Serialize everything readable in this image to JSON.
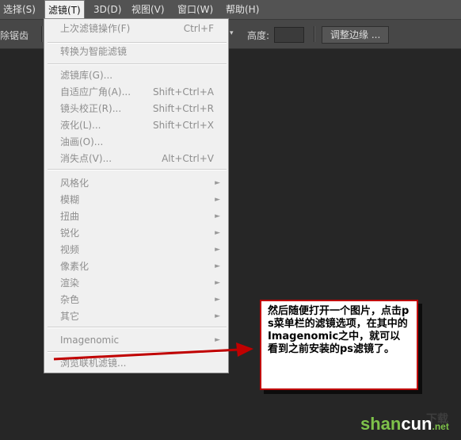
{
  "menubar": {
    "items": [
      {
        "label": "选择(S)"
      },
      {
        "label": "滤镜(T)",
        "active": true
      },
      {
        "label": "3D(D)"
      },
      {
        "label": "视图(V)"
      },
      {
        "label": "窗口(W)"
      },
      {
        "label": "帮助(H)"
      }
    ]
  },
  "optionsbar": {
    "partial_label": "除锯齿",
    "height_label": "高度:",
    "refine_edge_label": "调整边缘 ..."
  },
  "filter_menu": {
    "items": [
      {
        "label": "上次滤镜操作(F)",
        "shortcut": "Ctrl+F"
      },
      {
        "label": "转换为智能滤镜",
        "shortcut": ""
      },
      {
        "label": "滤镜库(G)...",
        "shortcut": ""
      },
      {
        "label": "自适应广角(A)...",
        "shortcut": "Shift+Ctrl+A"
      },
      {
        "label": "镜头校正(R)...",
        "shortcut": "Shift+Ctrl+R"
      },
      {
        "label": "液化(L)...",
        "shortcut": "Shift+Ctrl+X"
      },
      {
        "label": "油画(O)...",
        "shortcut": ""
      },
      {
        "label": "消失点(V)...",
        "shortcut": "Alt+Ctrl+V"
      },
      {
        "label": "风格化",
        "submenu": true
      },
      {
        "label": "模糊",
        "submenu": true
      },
      {
        "label": "扭曲",
        "submenu": true
      },
      {
        "label": "锐化",
        "submenu": true
      },
      {
        "label": "视频",
        "submenu": true
      },
      {
        "label": "像素化",
        "submenu": true
      },
      {
        "label": "渲染",
        "submenu": true
      },
      {
        "label": "杂色",
        "submenu": true
      },
      {
        "label": "其它",
        "submenu": true
      },
      {
        "label": "Imagenomic",
        "submenu": true
      },
      {
        "label": "浏览联机滤镜...",
        "shortcut": ""
      }
    ],
    "submenu_glyph": "►"
  },
  "callout": {
    "text": "然后随便打开一个图片，点击ps菜单栏的滤镜选项，在其中的Imagenomic之中，就可以看到之前安装的ps滤镜了。"
  },
  "watermark": {
    "brand_green": "shan",
    "brand_white": "cun",
    "suffix": ".net",
    "top_text": "下载"
  },
  "colors": {
    "arrow": "#c00000",
    "callout_border": "#c00000",
    "watermark_green": "#7ec24a"
  }
}
